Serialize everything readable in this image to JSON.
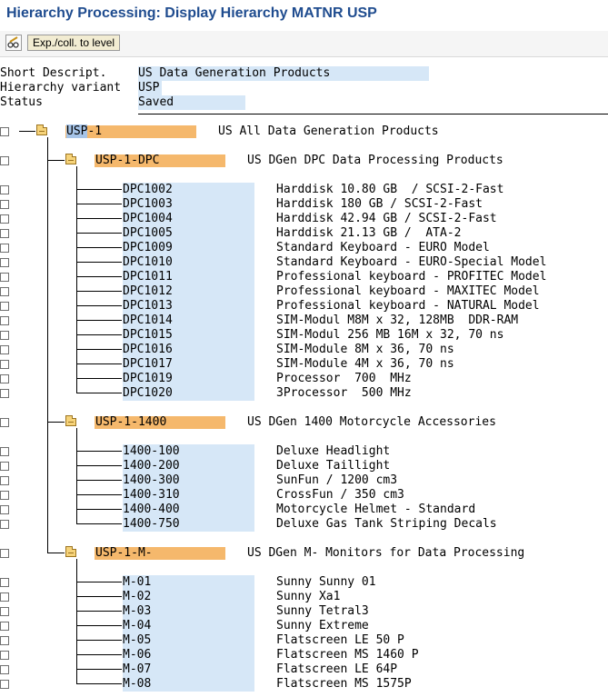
{
  "title": "Hierarchy Processing: Display Hierarchy MATNR USP",
  "toolbar": {
    "expand_label": "Exp./coll. to level"
  },
  "header": [
    {
      "label": "Short Descript.",
      "value": "US Data Generation Products"
    },
    {
      "label": "Hierarchy variant",
      "value": "USP"
    },
    {
      "label": "Status",
      "value": "Saved"
    }
  ],
  "root": {
    "id_prefix": "USP",
    "id_rest": "-1",
    "desc": "US All Data Generation Products"
  },
  "groups": [
    {
      "id": "USP-1-DPC",
      "desc": "US DGen DPC Data Processing Products",
      "items": [
        {
          "id": "DPC1002",
          "desc": "Harddisk 10.80 GB  / SCSI-2-Fast"
        },
        {
          "id": "DPC1003",
          "desc": "Harddisk 180 GB / SCSI-2-Fast"
        },
        {
          "id": "DPC1004",
          "desc": "Harddisk 42.94 GB / SCSI-2-Fast"
        },
        {
          "id": "DPC1005",
          "desc": "Harddisk 21.13 GB /  ATA-2"
        },
        {
          "id": "DPC1009",
          "desc": "Standard Keyboard - EURO Model"
        },
        {
          "id": "DPC1010",
          "desc": "Standard Keyboard - EURO-Special Model"
        },
        {
          "id": "DPC1011",
          "desc": "Professional keyboard - PROFITEC Model"
        },
        {
          "id": "DPC1012",
          "desc": "Professional keyboard - MAXITEC Model"
        },
        {
          "id": "DPC1013",
          "desc": "Professional keyboard - NATURAL Model"
        },
        {
          "id": "DPC1014",
          "desc": "SIM-Modul M8M x 32, 128MB  DDR-RAM"
        },
        {
          "id": "DPC1015",
          "desc": "SIM-Modul 256 MB 16M x 32, 70 ns"
        },
        {
          "id": "DPC1016",
          "desc": "SIM-Module 8M x 36, 70 ns"
        },
        {
          "id": "DPC1017",
          "desc": "SIM-Module 4M x 36, 70 ns"
        },
        {
          "id": "DPC1019",
          "desc": "Processor  700  MHz"
        },
        {
          "id": "DPC1020",
          "desc": "3Processor  500 MHz"
        }
      ]
    },
    {
      "id": "USP-1-1400",
      "desc": "US DGen 1400 Motorcycle Accessories",
      "items": [
        {
          "id": "1400-100",
          "desc": "Deluxe Headlight"
        },
        {
          "id": "1400-200",
          "desc": "Deluxe Taillight"
        },
        {
          "id": "1400-300",
          "desc": "SunFun / 1200 cm3"
        },
        {
          "id": "1400-310",
          "desc": "CrossFun / 350 cm3"
        },
        {
          "id": "1400-400",
          "desc": "Motorcycle Helmet - Standard"
        },
        {
          "id": "1400-750",
          "desc": "Deluxe Gas Tank Striping Decals"
        }
      ]
    },
    {
      "id": "USP-1-M-",
      "desc": "US DGen M- Monitors for Data Processing",
      "items": [
        {
          "id": "M-01",
          "desc": "Sunny Sunny 01"
        },
        {
          "id": "M-02",
          "desc": "Sunny Xa1"
        },
        {
          "id": "M-03",
          "desc": "Sunny Tetral3"
        },
        {
          "id": "M-04",
          "desc": "Sunny Extreme"
        },
        {
          "id": "M-05",
          "desc": "Flatscreen LE 50 P"
        },
        {
          "id": "M-06",
          "desc": "Flatscreen MS 1460 P"
        },
        {
          "id": "M-07",
          "desc": "Flatscreen LE 64P"
        },
        {
          "id": "M-08",
          "desc": "Flatscreen MS 1575P"
        }
      ]
    }
  ],
  "colors": {
    "title": "#1f4c8f",
    "node_highlight": "#f5b86c",
    "field_bg": "#d6e7f7"
  }
}
